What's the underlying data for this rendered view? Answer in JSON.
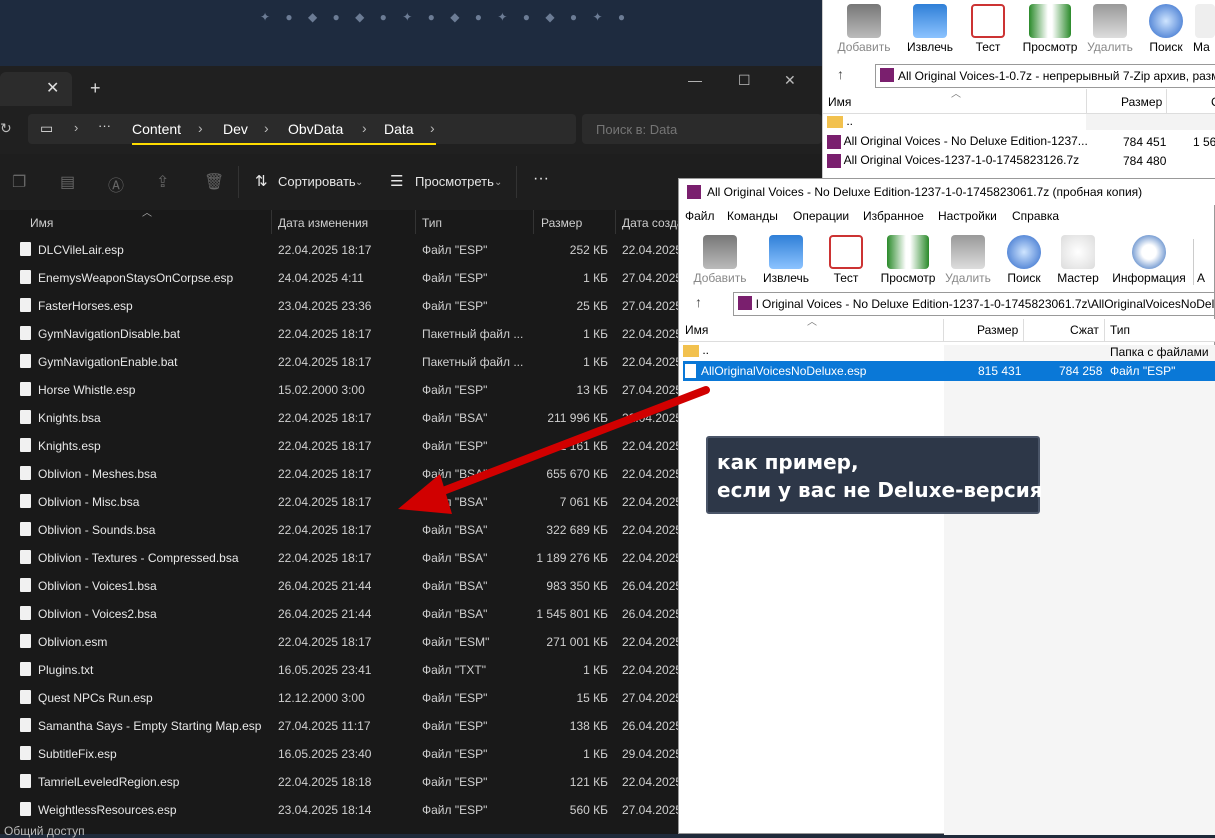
{
  "explorer": {
    "breadcrumb": [
      "Content",
      "Dev",
      "ObvData",
      "Data"
    ],
    "search_placeholder": "Поиск в: Data",
    "toolbar": {
      "sort_label": "Сортировать",
      "view_label": "Просмотреть",
      "more_label": "···"
    },
    "columns": {
      "name": "Имя",
      "date": "Дата изменения",
      "type": "Тип",
      "size": "Размер",
      "created": "Дата созда"
    },
    "files": [
      {
        "name": "DLCVileLair.esp",
        "date": "22.04.2025 18:17",
        "type": "Файл \"ESP\"",
        "size": "252 КБ",
        "created": "22.04.2025"
      },
      {
        "name": "EnemysWeaponStaysOnCorpse.esp",
        "date": "24.04.2025 4:11",
        "type": "Файл \"ESP\"",
        "size": "1 КБ",
        "created": "27.04.2025"
      },
      {
        "name": "FasterHorses.esp",
        "date": "23.04.2025 23:36",
        "type": "Файл \"ESP\"",
        "size": "25 КБ",
        "created": "27.04.2025"
      },
      {
        "name": "GymNavigationDisable.bat",
        "date": "22.04.2025 18:17",
        "type": "Пакетный файл ...",
        "size": "1 КБ",
        "created": "22.04.2025"
      },
      {
        "name": "GymNavigationEnable.bat",
        "date": "22.04.2025 18:17",
        "type": "Пакетный файл ...",
        "size": "1 КБ",
        "created": "22.04.2025"
      },
      {
        "name": "Horse Whistle.esp",
        "date": "15.02.2000 3:00",
        "type": "Файл \"ESP\"",
        "size": "13 КБ",
        "created": "27.04.2025"
      },
      {
        "name": "Knights.bsa",
        "date": "22.04.2025 18:17",
        "type": "Файл \"BSA\"",
        "size": "211 996 КБ",
        "created": "22.04.2025"
      },
      {
        "name": "Knights.esp",
        "date": "22.04.2025 18:17",
        "type": "Файл \"ESP\"",
        "size": "2 161 КБ",
        "created": "22.04.2025"
      },
      {
        "name": "Oblivion - Meshes.bsa",
        "date": "22.04.2025 18:17",
        "type": "Файл \"BSA\"",
        "size": "655 670 КБ",
        "created": "22.04.2025"
      },
      {
        "name": "Oblivion - Misc.bsa",
        "date": "22.04.2025 18:17",
        "type": "Файл \"BSA\"",
        "size": "7 061 КБ",
        "created": "22.04.2025"
      },
      {
        "name": "Oblivion - Sounds.bsa",
        "date": "22.04.2025 18:17",
        "type": "Файл \"BSA\"",
        "size": "322 689 КБ",
        "created": "22.04.2025"
      },
      {
        "name": "Oblivion - Textures - Compressed.bsa",
        "date": "22.04.2025 18:17",
        "type": "Файл \"BSA\"",
        "size": "1 189 276 КБ",
        "created": "22.04.2025"
      },
      {
        "name": "Oblivion - Voices1.bsa",
        "date": "26.04.2025 21:44",
        "type": "Файл \"BSA\"",
        "size": "983 350 КБ",
        "created": "26.04.2025"
      },
      {
        "name": "Oblivion - Voices2.bsa",
        "date": "26.04.2025 21:44",
        "type": "Файл \"BSA\"",
        "size": "1 545 801 КБ",
        "created": "26.04.2025"
      },
      {
        "name": "Oblivion.esm",
        "date": "22.04.2025 18:17",
        "type": "Файл \"ESM\"",
        "size": "271 001 КБ",
        "created": "22.04.2025"
      },
      {
        "name": "Plugins.txt",
        "date": "16.05.2025 23:41",
        "type": "Файл \"TXT\"",
        "size": "1 КБ",
        "created": "22.04.2025"
      },
      {
        "name": "Quest NPCs Run.esp",
        "date": "12.12.2000 3:00",
        "type": "Файл \"ESP\"",
        "size": "15 КБ",
        "created": "27.04.2025"
      },
      {
        "name": "Samantha Says - Empty Starting Map.esp",
        "date": "27.04.2025 11:17",
        "type": "Файл \"ESP\"",
        "size": "138 КБ",
        "created": "26.04.2025"
      },
      {
        "name": "SubtitleFix.esp",
        "date": "16.05.2025 23:40",
        "type": "Файл \"ESP\"",
        "size": "1 КБ",
        "created": "29.04.2025"
      },
      {
        "name": "TamrielLeveledRegion.esp",
        "date": "22.04.2025 18:18",
        "type": "Файл \"ESP\"",
        "size": "121 КБ",
        "created": "22.04.2025"
      },
      {
        "name": "WeightlessResources.esp",
        "date": "23.04.2025 18:14",
        "type": "Файл \"ESP\"",
        "size": "560 КБ",
        "created": "27.04.2025"
      }
    ],
    "status_left": "Общий доступ"
  },
  "zip1": {
    "toolbar": [
      "Добавить",
      "Извлечь",
      "Тест",
      "Просмотр",
      "Удалить",
      "Поиск",
      "Ма"
    ],
    "path": "All Original Voices-1-0.7z - непрерывный 7-Zip архив, разм",
    "columns": {
      "name": "Имя",
      "size": "Размер"
    },
    "rows": [
      {
        "name": "..",
        "size": "",
        "packed": ""
      },
      {
        "name": "All Original Voices - No Deluxe Edition-1237...",
        "size": "784 451",
        "packed": "1 56"
      },
      {
        "name": "All Original Voices-1237-1-0-1745823126.7z",
        "size": "784 480",
        "packed": ""
      }
    ]
  },
  "zip2": {
    "title": "All Original Voices - No Deluxe Edition-1237-1-0-1745823061.7z (пробная копия)",
    "menu": [
      "Файл",
      "Команды",
      "Операции",
      "Избранное",
      "Настройки",
      "Справка"
    ],
    "toolbar": [
      "Добавить",
      "Извлечь",
      "Тест",
      "Просмотр",
      "Удалить",
      "Поиск",
      "Мастер",
      "Информация",
      "А"
    ],
    "path": "l Original Voices - No Deluxe Edition-1237-1-0-1745823061.7z\\AllOriginalVoicesNoDelux",
    "columns": {
      "name": "Имя",
      "size": "Размер",
      "packed": "Сжат",
      "type": "Тип"
    },
    "rows": [
      {
        "name": "..",
        "size": "",
        "packed": "",
        "type": "Папка с файлами"
      },
      {
        "name": "AllOriginalVoicesNoDeluxe.esp",
        "size": "815 431",
        "packed": "784 258",
        "type": "Файл \"ESP\""
      }
    ]
  },
  "callout": {
    "line1": "как пример,",
    "line2": "если у вас не Deluxe-версия"
  }
}
